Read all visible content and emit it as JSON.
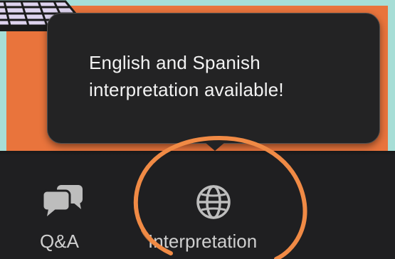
{
  "tooltip": {
    "text": "English and Spanish interpretation available!"
  },
  "toolbar": {
    "qa_label": "Q&A",
    "interpretation_label": "Interpretation"
  },
  "icons": {
    "qa": "chat-bubbles-icon",
    "interpretation": "globe-icon"
  },
  "colors": {
    "toolbar_bg": "#1f1f21",
    "tooltip_bg": "#232324",
    "highlight_ring": "#f08a45",
    "backdrop_orange": "#e9743c",
    "backdrop_teal": "#a7ded6"
  }
}
